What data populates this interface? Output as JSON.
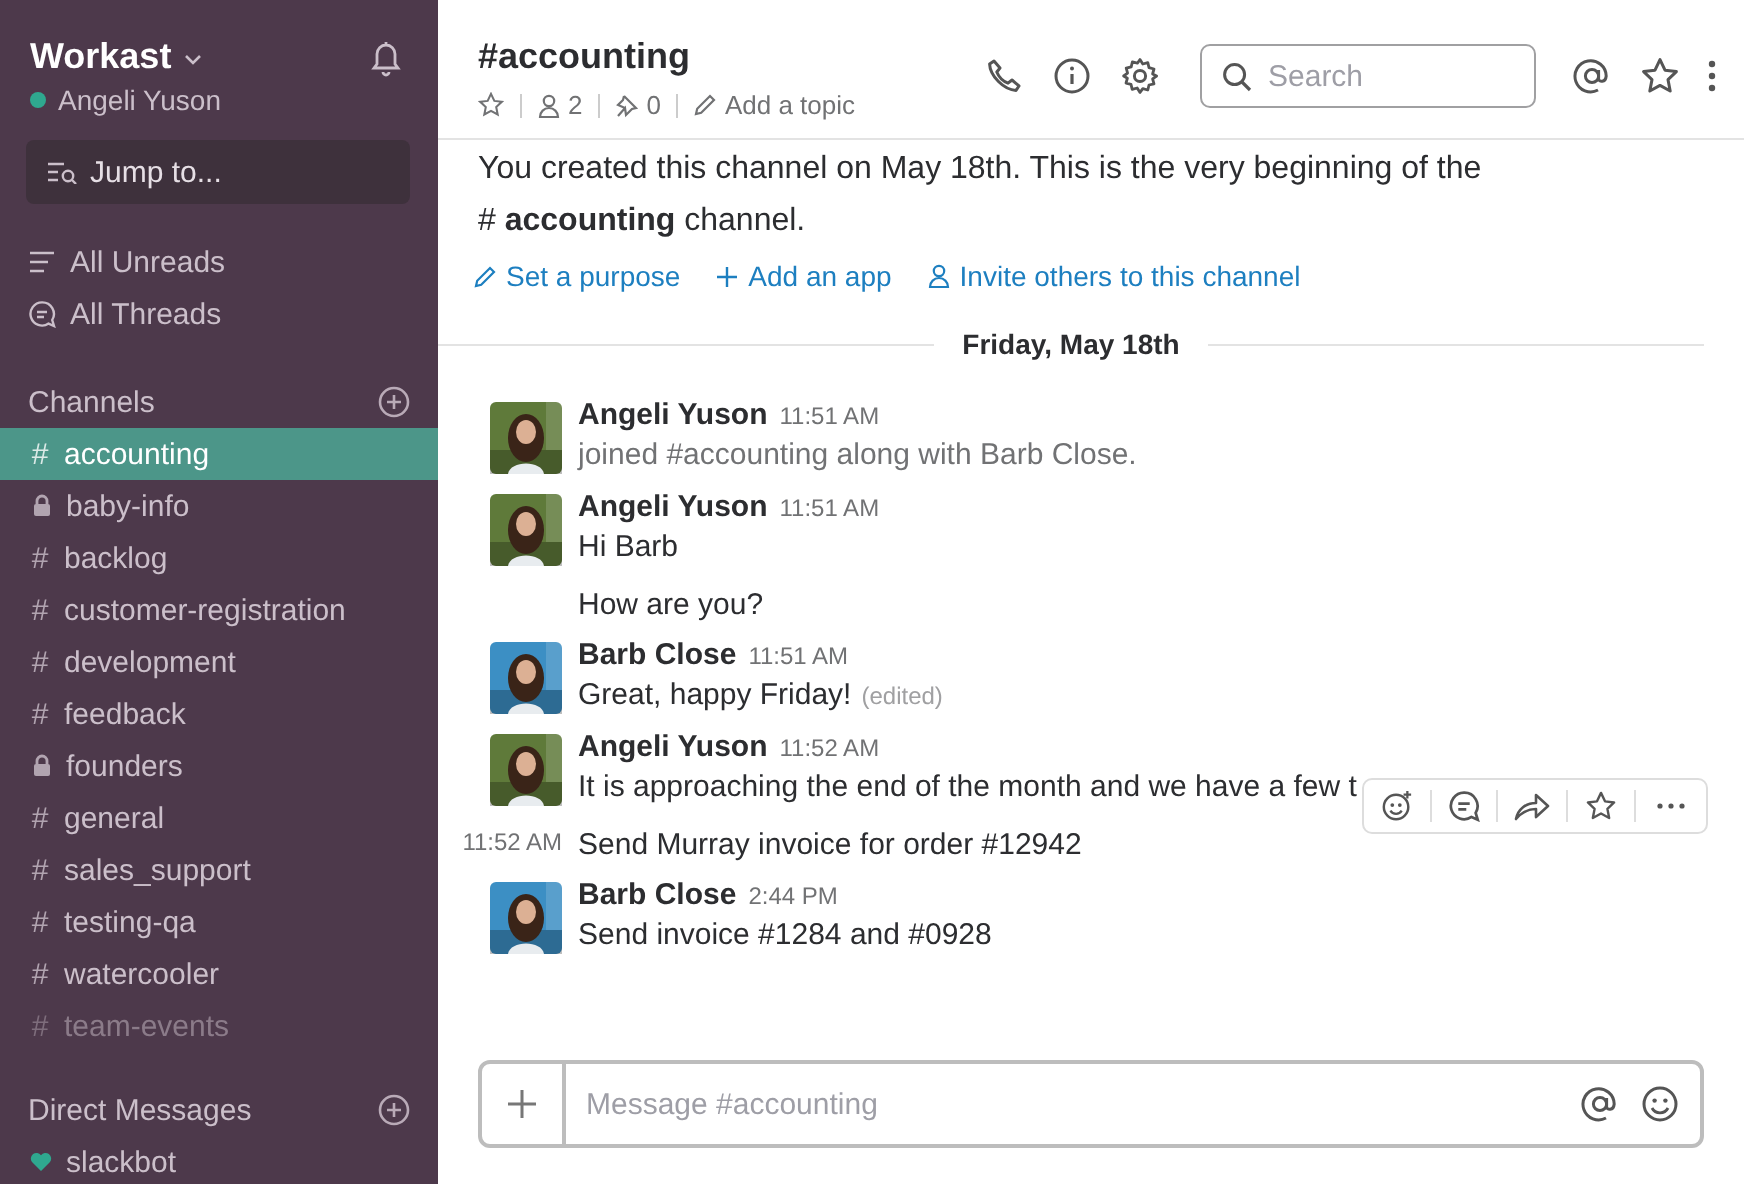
{
  "sidebar": {
    "team": "Workast",
    "user": {
      "name": "Angeli Yuson",
      "online": true
    },
    "jump": {
      "placeholder": "Jump to..."
    },
    "nav": [
      {
        "label": "All Unreads",
        "kind": "unreads"
      },
      {
        "label": "All Threads",
        "kind": "threads"
      }
    ],
    "channels_title": "Channels",
    "channels": [
      {
        "name": "accounting",
        "kind": "public",
        "prefix": "#",
        "selected": true,
        "muted": false
      },
      {
        "name": "baby-info",
        "kind": "private",
        "selected": false,
        "muted": false
      },
      {
        "name": "backlog",
        "kind": "public",
        "prefix": "#",
        "selected": false,
        "muted": false
      },
      {
        "name": "customer-registration",
        "kind": "public",
        "prefix": "#",
        "selected": false,
        "muted": false
      },
      {
        "name": "development",
        "kind": "public",
        "prefix": "#",
        "selected": false,
        "muted": false
      },
      {
        "name": "feedback",
        "kind": "public",
        "prefix": "#",
        "selected": false,
        "muted": false
      },
      {
        "name": "founders",
        "kind": "private",
        "selected": false,
        "muted": false
      },
      {
        "name": "general",
        "kind": "public",
        "prefix": "#",
        "selected": false,
        "muted": false
      },
      {
        "name": "sales_support",
        "kind": "public",
        "prefix": "#",
        "selected": false,
        "muted": false
      },
      {
        "name": "testing-qa",
        "kind": "public",
        "prefix": "#",
        "selected": false,
        "muted": false
      },
      {
        "name": "watercooler",
        "kind": "public",
        "prefix": "#",
        "selected": false,
        "muted": false
      },
      {
        "name": "team-events",
        "kind": "public",
        "prefix": "#",
        "selected": false,
        "muted": true
      }
    ],
    "dm_title": "Direct Messages",
    "dms": [
      {
        "name": "slackbot",
        "kind": "bot"
      }
    ]
  },
  "channel": {
    "title": "#accounting",
    "members": "2",
    "pins": "0",
    "topic": "Add a topic"
  },
  "search": {
    "placeholder": "Search"
  },
  "intro": {
    "text": "You created this channel on May 18th. This is the very beginning of the",
    "hash": "#",
    "channel": "accounting",
    "tail": "channel."
  },
  "actions": [
    {
      "label": "Set a purpose",
      "kind": "pencil"
    },
    {
      "label": "Add an app",
      "kind": "plus"
    },
    {
      "label": "Invite others to this channel",
      "kind": "person"
    }
  ],
  "day": "Friday, May 18th",
  "messages": [
    {
      "kind": "full",
      "author": "Angeli Yuson",
      "color": "#5f7a3a",
      "time": "11:51 AM",
      "text": "joined #accounting along with Barb Close.",
      "system": true
    },
    {
      "kind": "full",
      "author": "Angeli Yuson",
      "color": "#5f7a3a",
      "time": "11:51 AM",
      "text": "Hi Barb"
    },
    {
      "kind": "continuation",
      "text": "How are you?"
    },
    {
      "kind": "full",
      "author": "Barb Close",
      "color": "#3c8fc4",
      "time": "11:51 AM",
      "text": "Great, happy Friday!",
      "edited": "(edited)"
    },
    {
      "kind": "full",
      "author": "Angeli Yuson",
      "color": "#5f7a3a",
      "time": "11:52 AM",
      "text": "It is approaching the end of the month and we have a few t",
      "hover": true
    },
    {
      "kind": "continuation",
      "time": "11:52 AM",
      "text": "Send Murray invoice for order #12942"
    },
    {
      "kind": "full",
      "author": "Barb Close",
      "color": "#3c8fc4",
      "time": "2:44 PM",
      "text": "Send invoice #1284 and #0928"
    }
  ],
  "composer": {
    "placeholder": "Message #accounting"
  }
}
